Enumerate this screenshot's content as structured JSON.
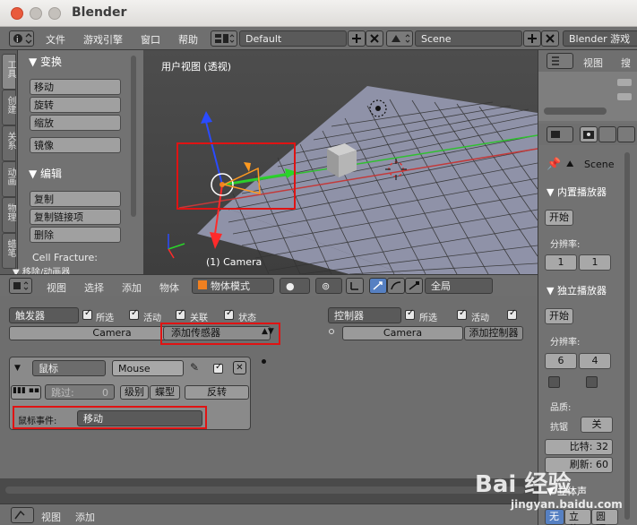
{
  "window": {
    "title": "Blender"
  },
  "menubar": {
    "items": [
      "文件",
      "游戏引擎",
      "窗口",
      "帮助"
    ],
    "layout_value": "Default",
    "scene_value": "Scene",
    "engine_value": "Blender 游戏"
  },
  "left_tabs": [
    "工具",
    "创建",
    "关系",
    "动画",
    "物理",
    "蜡笔"
  ],
  "toolshelf": {
    "transform_header": "▼ 变换",
    "transform_buttons": [
      "移动",
      "旋转",
      "缩放"
    ],
    "mirror_button": "镜像",
    "edit_header": "▼ 编辑",
    "edit_buttons": [
      "复制",
      "复制链接项",
      "删除"
    ],
    "cell_fracture": "Cell Fracture:",
    "partial": "▼ 移除/动画器"
  },
  "viewport": {
    "title": "用户视图 (透视)",
    "object_label": "(1) Camera"
  },
  "viewport_header": {
    "items": [
      "视图",
      "选择",
      "添加",
      "物体"
    ],
    "mode": "物体模式",
    "orientation": "全局"
  },
  "logic": {
    "sensors_dropdown": "触发器",
    "controllers_dropdown": "控制器",
    "left_checks": [
      "所选",
      "活动",
      "关联",
      "状态"
    ],
    "right_checks": [
      "所选",
      "活动"
    ],
    "object_name": "Camera",
    "add_sensor": "添加传感器",
    "add_controller": "添加控制器",
    "sensor": {
      "type": "鼠标",
      "name": "Mouse",
      "skip_label": "跳过:",
      "skip_value": "0",
      "level": "级别",
      "tap": "蝶型",
      "invert": "反转",
      "event_label": "鼠标事件:",
      "event_value": "移动"
    }
  },
  "bottom_header": {
    "items": [
      "视图",
      "添加"
    ]
  },
  "right_top": {
    "items": [
      "视图",
      "搜索"
    ]
  },
  "properties": {
    "scene_label": "Scene",
    "embedded_header": "▼ 内置播放器",
    "start_button": "开始",
    "resolution_label": "分辨率:",
    "res_embedded": [
      "1",
      "1"
    ],
    "standalone_header": "▼ 独立播放器",
    "start_button2": "开始",
    "resolution_label2": "分辨率:",
    "res_standalone": [
      "6",
      "4"
    ],
    "quality_label": "品质:",
    "aa_label": "抗锯",
    "aa_value": "关",
    "bits": "比特: 32",
    "refresh": "刷新: 60",
    "stereo_header": "▼ 立体声",
    "stereo_opts": [
      "无",
      "立体",
      "圆顶"
    ]
  },
  "watermark": {
    "text": "Bai 经验",
    "url": "jingyan.baidu.com"
  },
  "colors": {
    "highlight_red": "#e01313",
    "axis_x": "#e03030",
    "axis_y": "#3c3cff",
    "grid_green": "#30c030"
  }
}
